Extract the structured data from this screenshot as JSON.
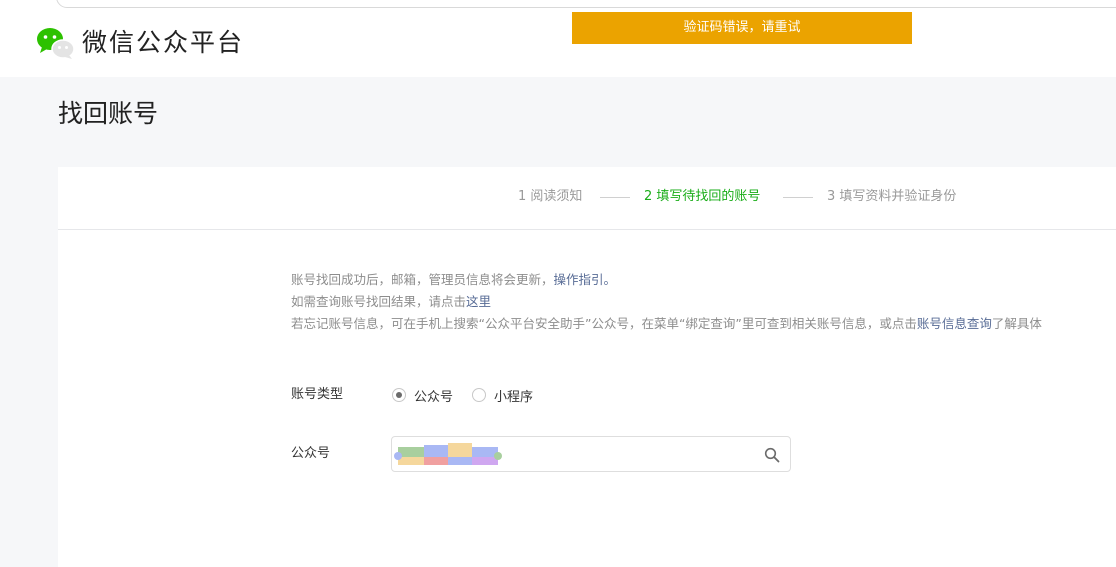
{
  "header": {
    "brand": "微信公众平台"
  },
  "toast": {
    "message": "验证码错误，请重试"
  },
  "page": {
    "title": "找回账号"
  },
  "steps": [
    {
      "label": "1 阅读须知",
      "state": "done"
    },
    {
      "label": "2 填写待找回的账号",
      "state": "active"
    },
    {
      "label": "3 填写资料并验证身份",
      "state": "todo"
    }
  ],
  "notice": {
    "line1_text": "账号找回成功后，邮箱，管理员信息将会更新，",
    "line1_link": "操作指引。",
    "line2_text": "如需查询账号找回结果，请点击",
    "line2_link": "这里",
    "line3_text": "若忘记账号信息，可在手机上搜索“公众平台安全助手”公众号，在菜单“绑定查询”里可查到相关账号信息，或点击",
    "line3_link": "账号信息查询",
    "line3_tail": "了解具体"
  },
  "form": {
    "account_type_label": "账号类型",
    "options": [
      {
        "label": "公众号",
        "checked": true
      },
      {
        "label": "小程序",
        "checked": false
      }
    ],
    "account_label": "公众号"
  },
  "colors": {
    "accent_green": "#1aad19",
    "toast_bg": "#eba300",
    "link": "#576b95"
  }
}
